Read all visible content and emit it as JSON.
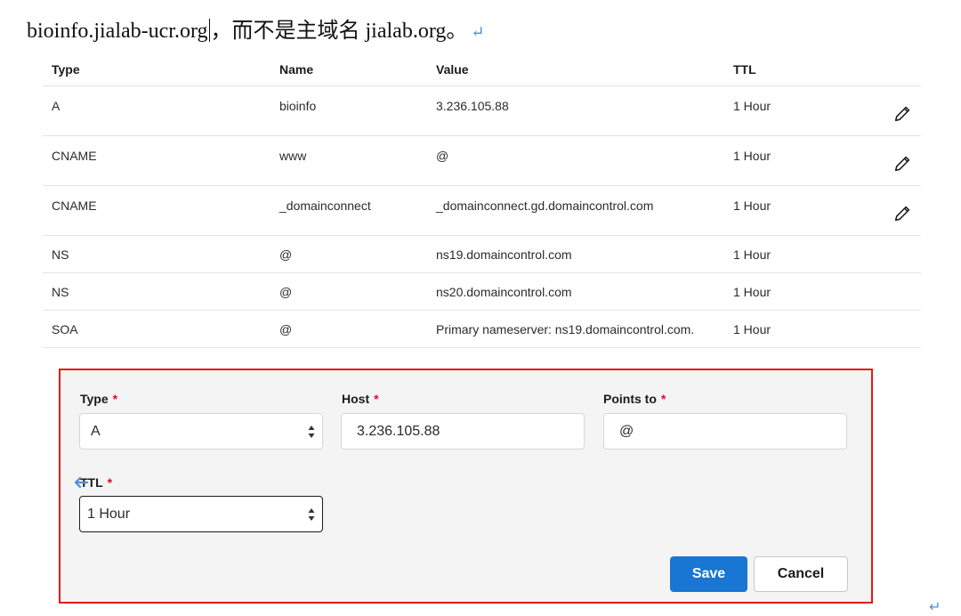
{
  "intro": {
    "domain_text": "bioinfo.jialab-ucr.org",
    "rest_text": "，而不是主域名 jialab.org。",
    "return_mark": "↵"
  },
  "table": {
    "headers": [
      "Type",
      "Name",
      "Value",
      "TTL"
    ],
    "rows": [
      {
        "type": "A",
        "name": "bioinfo",
        "value": "3.236.105.88",
        "ttl": "1 Hour",
        "editable": true
      },
      {
        "type": "CNAME",
        "name": "www",
        "value": "@",
        "ttl": "1 Hour",
        "editable": true
      },
      {
        "type": "CNAME",
        "name": "_domainconnect",
        "value": "_domainconnect.gd.domaincontrol.com",
        "ttl": "1 Hour",
        "editable": true
      },
      {
        "type": "NS",
        "name": "@",
        "value": "ns19.domaincontrol.com",
        "ttl": "1 Hour",
        "editable": false
      },
      {
        "type": "NS",
        "name": "@",
        "value": "ns20.domaincontrol.com",
        "ttl": "1 Hour",
        "editable": false
      },
      {
        "type": "SOA",
        "name": "@",
        "value": "Primary nameserver: ns19.domaincontrol.com.",
        "ttl": "1 Hour",
        "editable": false
      }
    ]
  },
  "form": {
    "type_label": "Type",
    "type_value": "A",
    "host_label": "Host",
    "host_value": "3.236.105.88",
    "points_label": "Points to",
    "points_value": "@",
    "ttl_label": "TTL",
    "ttl_value": "1 Hour",
    "required_mark": "*",
    "save_label": "Save",
    "cancel_label": "Cancel"
  },
  "icons": {
    "edit": "pencil-icon",
    "select": "updown-arrows-icon",
    "cursor": "mouse-cursor-icon"
  },
  "colors": {
    "highlight_border": "#e21b1b",
    "save_button": "#1976d2",
    "required": "#d1102b",
    "form_background": "#f4f4f5"
  },
  "page_return_mark": "↵"
}
